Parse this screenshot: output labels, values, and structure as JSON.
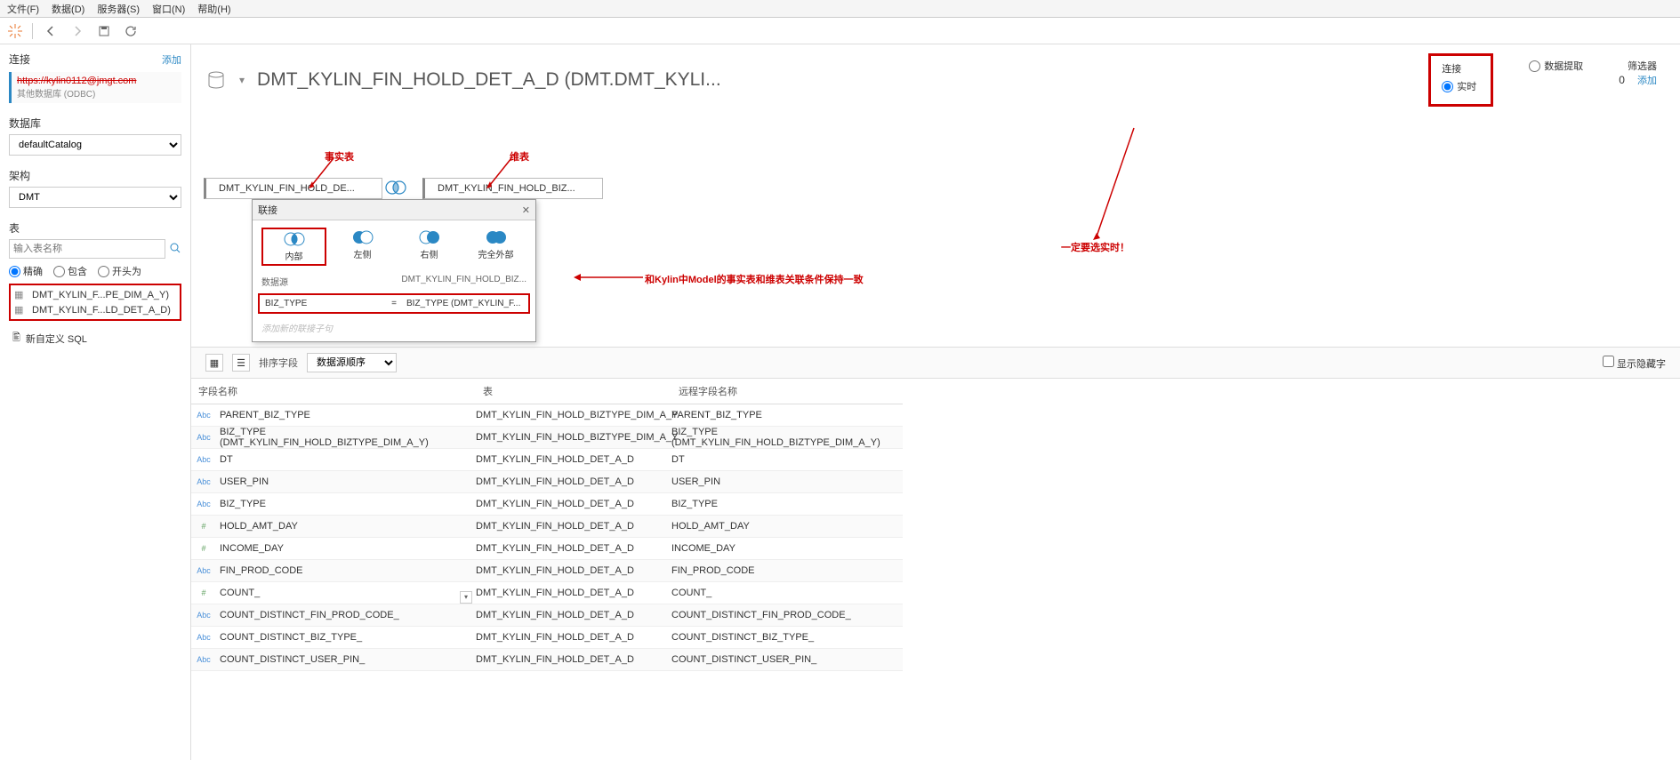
{
  "menu": {
    "file": "文件(F)",
    "data": "数据(D)",
    "server": "服务器(S)",
    "window": "窗口(N)",
    "help": "帮助(H)"
  },
  "sidebar": {
    "conn_header": "连接",
    "conn_add": "添加",
    "conn_name": "https://kylin0112@jmgt.com",
    "conn_sub": "其他数据库 (ODBC)",
    "database_label": "数据库",
    "database_value": "defaultCatalog",
    "schema_label": "架构",
    "schema_value": "DMT",
    "table_label": "表",
    "table_placeholder": "输入表名称",
    "radio_exact": "精确",
    "radio_contains": "包含",
    "radio_starts": "开头为",
    "tables": [
      "DMT_KYLIN_F...PE_DIM_A_Y)",
      "DMT_KYLIN_F...LD_DET_A_D)"
    ],
    "custom_sql": "新自定义 SQL"
  },
  "header": {
    "title": "DMT_KYLIN_FIN_HOLD_DET_A_D (DMT.DMT_KYLI...",
    "conn_title": "连接",
    "conn_live": "实时",
    "conn_extract": "数据提取",
    "filter_label": "筛选器",
    "filter_count": "0",
    "filter_add": "添加"
  },
  "canvas": {
    "table1": "DMT_KYLIN_FIN_HOLD_DE...",
    "table2": "DMT_KYLIN_FIN_HOLD_BIZ...",
    "anno_fact": "事实表",
    "anno_dim": "维表",
    "anno_cond": "和Kylin中Model的事实表和维表关联条件保持一致",
    "anno_realtime": "一定要选实时！"
  },
  "join_popup": {
    "title": "联接",
    "types": {
      "inner": "内部",
      "left": "左侧",
      "right": "右侧",
      "full": "完全外部"
    },
    "source_left": "数据源",
    "source_right": "DMT_KYLIN_FIN_HOLD_BIZ...",
    "cond_left": "BIZ_TYPE",
    "cond_op": "=",
    "cond_right": "BIZ_TYPE (DMT_KYLIN_F...",
    "add_cond": "添加新的联接子句"
  },
  "grid": {
    "sort_label": "排序字段",
    "sort_value": "数据源顺序",
    "show_hidden": "显示隐藏字",
    "col_name": "字段名称",
    "col_table": "表",
    "col_remote": "远程字段名称",
    "rows": [
      {
        "type": "abc",
        "name": "PARENT_BIZ_TYPE",
        "table": "DMT_KYLIN_FIN_HOLD_BIZTYPE_DIM_A_Y",
        "remote": "PARENT_BIZ_TYPE"
      },
      {
        "type": "abc",
        "name": "BIZ_TYPE (DMT_KYLIN_FIN_HOLD_BIZTYPE_DIM_A_Y)",
        "table": "DMT_KYLIN_FIN_HOLD_BIZTYPE_DIM_A_Y",
        "remote": "BIZ_TYPE (DMT_KYLIN_FIN_HOLD_BIZTYPE_DIM_A_Y)"
      },
      {
        "type": "abc",
        "name": "DT",
        "table": "DMT_KYLIN_FIN_HOLD_DET_A_D",
        "remote": "DT"
      },
      {
        "type": "abc",
        "name": "USER_PIN",
        "table": "DMT_KYLIN_FIN_HOLD_DET_A_D",
        "remote": "USER_PIN"
      },
      {
        "type": "abc",
        "name": "BIZ_TYPE",
        "table": "DMT_KYLIN_FIN_HOLD_DET_A_D",
        "remote": "BIZ_TYPE"
      },
      {
        "type": "num",
        "name": "HOLD_AMT_DAY",
        "table": "DMT_KYLIN_FIN_HOLD_DET_A_D",
        "remote": "HOLD_AMT_DAY"
      },
      {
        "type": "num",
        "name": "INCOME_DAY",
        "table": "DMT_KYLIN_FIN_HOLD_DET_A_D",
        "remote": "INCOME_DAY"
      },
      {
        "type": "abc",
        "name": "FIN_PROD_CODE",
        "table": "DMT_KYLIN_FIN_HOLD_DET_A_D",
        "remote": "FIN_PROD_CODE"
      },
      {
        "type": "num",
        "name": "COUNT_",
        "table": "DMT_KYLIN_FIN_HOLD_DET_A_D",
        "remote": "COUNT_",
        "dd": true
      },
      {
        "type": "abc",
        "name": "COUNT_DISTINCT_FIN_PROD_CODE_",
        "table": "DMT_KYLIN_FIN_HOLD_DET_A_D",
        "remote": "COUNT_DISTINCT_FIN_PROD_CODE_"
      },
      {
        "type": "abc",
        "name": "COUNT_DISTINCT_BIZ_TYPE_",
        "table": "DMT_KYLIN_FIN_HOLD_DET_A_D",
        "remote": "COUNT_DISTINCT_BIZ_TYPE_"
      },
      {
        "type": "abc",
        "name": "COUNT_DISTINCT_USER_PIN_",
        "table": "DMT_KYLIN_FIN_HOLD_DET_A_D",
        "remote": "COUNT_DISTINCT_USER_PIN_"
      }
    ]
  }
}
